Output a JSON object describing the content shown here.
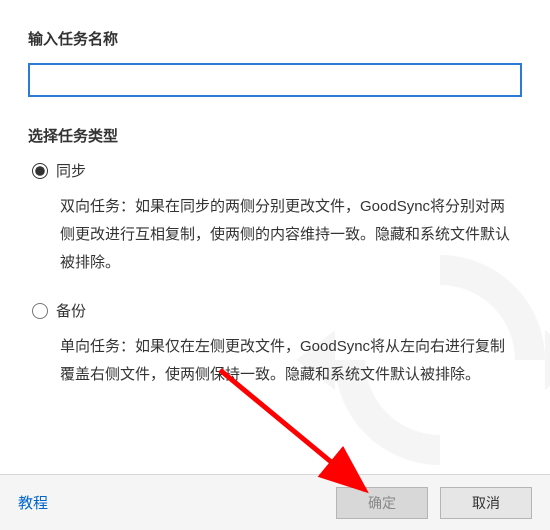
{
  "labels": {
    "taskName": "输入任务名称",
    "taskType": "选择任务类型"
  },
  "input": {
    "taskNameValue": "",
    "taskNamePlaceholder": ""
  },
  "options": {
    "sync": {
      "label": "同步",
      "description": "双向任务：如果在同步的两侧分别更改文件，GoodSync将分别对两侧更改进行互相复制，使两侧的内容维持一致。隐藏和系统文件默认被排除。"
    },
    "backup": {
      "label": "备份",
      "description": "单向任务：如果仅在左侧更改文件，GoodSync将从左向右进行复制覆盖右侧文件，使两侧保持一致。隐藏和系统文件默认被排除。"
    },
    "selected": "sync"
  },
  "footer": {
    "tutorial": "教程",
    "ok": "确定",
    "cancel": "取消"
  }
}
